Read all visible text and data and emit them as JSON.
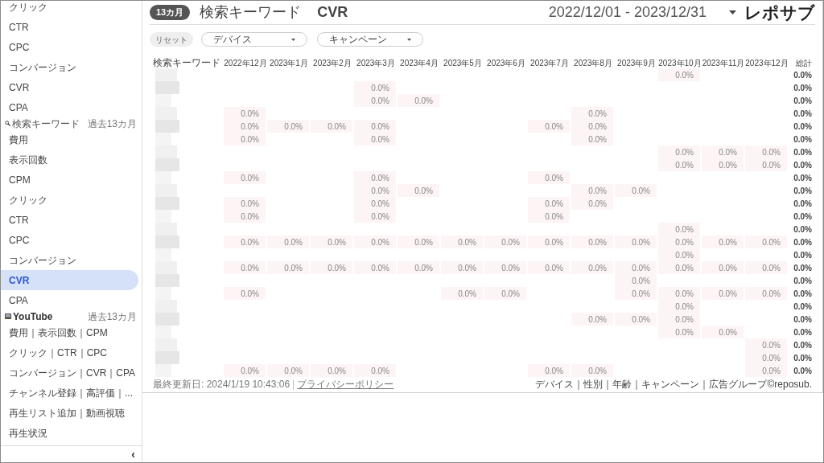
{
  "sidebar": {
    "items": [
      {
        "kind": "item",
        "label": "クリック",
        "selected": false
      },
      {
        "kind": "item",
        "label": "CTR",
        "selected": false
      },
      {
        "kind": "item",
        "label": "CPC",
        "selected": false
      },
      {
        "kind": "item",
        "label": "コンバージョン",
        "selected": false
      },
      {
        "kind": "item",
        "label": "CVR",
        "selected": false
      },
      {
        "kind": "item",
        "label": "CPA",
        "selected": false
      },
      {
        "kind": "header",
        "label": "検索キーワード",
        "period": "過去13カ月"
      },
      {
        "kind": "item",
        "label": "費用",
        "selected": false
      },
      {
        "kind": "item",
        "label": "表示回数",
        "selected": false
      },
      {
        "kind": "item",
        "label": "CPM",
        "selected": false
      },
      {
        "kind": "item",
        "label": "クリック",
        "selected": false
      },
      {
        "kind": "item",
        "label": "CTR",
        "selected": false
      },
      {
        "kind": "item",
        "label": "CPC",
        "selected": false
      },
      {
        "kind": "item",
        "label": "コンバージョン",
        "selected": false
      },
      {
        "kind": "item",
        "label": "CVR",
        "selected": true
      },
      {
        "kind": "item",
        "label": "CPA",
        "selected": false
      },
      {
        "kind": "header",
        "label": "YouTube",
        "period": "過去13カ月"
      },
      {
        "kind": "item",
        "label": "費用｜表示回数｜CPM",
        "selected": false
      },
      {
        "kind": "item",
        "label": "クリック｜CTR｜CPC",
        "selected": false
      },
      {
        "kind": "item",
        "label": "コンバージョン｜CVR｜CPA",
        "selected": false
      },
      {
        "kind": "item",
        "label": "チャンネル登録｜高評価｜...",
        "selected": false
      },
      {
        "kind": "item",
        "label": "再生リスト追加｜動画視聴",
        "selected": false
      },
      {
        "kind": "item",
        "label": "再生状況",
        "selected": false
      }
    ],
    "collapse": "‹"
  },
  "header": {
    "badge": "13カ月",
    "title": "検索キーワード",
    "metric": "CVR",
    "date_range": "2022/12/01 - 2023/12/31",
    "logo": "レポサブ"
  },
  "filters": {
    "reset": "リセット",
    "dropdowns": [
      "デバイス",
      "キャンペーン"
    ]
  },
  "table": {
    "keyword_header": "検索キーワード",
    "total_header": "総計",
    "columns": [
      "2022年12月",
      "2023年1月",
      "2023年2月",
      "2023年3月",
      "2023年4月",
      "2023年5月",
      "2023年6月",
      "2023年7月",
      "2023年8月",
      "2023年9月",
      "2023年10月",
      "2023年11月",
      "2023年12月"
    ],
    "rows": [
      {
        "cells": [
          null,
          null,
          null,
          null,
          null,
          null,
          null,
          null,
          null,
          null,
          "0.0%",
          null,
          null
        ],
        "total": "0.0%"
      },
      {
        "cells": [
          null,
          null,
          null,
          "0.0%",
          null,
          null,
          null,
          null,
          null,
          null,
          null,
          null,
          null
        ],
        "total": "0.0%"
      },
      {
        "cells": [
          null,
          null,
          null,
          "0.0%",
          "0.0%",
          null,
          null,
          null,
          null,
          null,
          null,
          null,
          null
        ],
        "total": "0.0%"
      },
      {
        "cells": [
          "0.0%",
          null,
          null,
          null,
          null,
          null,
          null,
          null,
          "0.0%",
          null,
          null,
          null,
          null
        ],
        "total": "0.0%"
      },
      {
        "cells": [
          "0.0%",
          "0.0%",
          "0.0%",
          "0.0%",
          null,
          null,
          null,
          "0.0%",
          "0.0%",
          null,
          null,
          null,
          null
        ],
        "total": "0.0%"
      },
      {
        "cells": [
          "0.0%",
          null,
          null,
          "0.0%",
          null,
          null,
          null,
          null,
          "0.0%",
          null,
          null,
          null,
          null
        ],
        "total": "0.0%"
      },
      {
        "cells": [
          null,
          null,
          null,
          null,
          null,
          null,
          null,
          null,
          null,
          null,
          "0.0%",
          "0.0%",
          "0.0%"
        ],
        "total": "0.0%"
      },
      {
        "cells": [
          null,
          null,
          null,
          null,
          null,
          null,
          null,
          null,
          null,
          null,
          "0.0%",
          "0.0%",
          "0.0%"
        ],
        "total": "0.0%"
      },
      {
        "cells": [
          "0.0%",
          null,
          null,
          "0.0%",
          null,
          null,
          null,
          "0.0%",
          null,
          null,
          null,
          null,
          null
        ],
        "total": "0.0%"
      },
      {
        "cells": [
          null,
          null,
          null,
          "0.0%",
          "0.0%",
          null,
          null,
          null,
          "0.0%",
          "0.0%",
          null,
          null,
          null
        ],
        "total": "0.0%"
      },
      {
        "cells": [
          "0.0%",
          null,
          null,
          "0.0%",
          null,
          null,
          null,
          "0.0%",
          "0.0%",
          null,
          null,
          null,
          null
        ],
        "total": "0.0%"
      },
      {
        "cells": [
          "0.0%",
          null,
          null,
          "0.0%",
          null,
          null,
          null,
          "0.0%",
          null,
          null,
          null,
          null,
          null
        ],
        "total": "0.0%"
      },
      {
        "cells": [
          null,
          null,
          null,
          null,
          null,
          null,
          null,
          null,
          null,
          null,
          "0.0%",
          null,
          null
        ],
        "total": "0.0%"
      },
      {
        "cells": [
          "0.0%",
          "0.0%",
          "0.0%",
          "0.0%",
          "0.0%",
          "0.0%",
          "0.0%",
          "0.0%",
          "0.0%",
          "0.0%",
          "0.0%",
          "0.0%",
          "0.0%"
        ],
        "total": "0.0%"
      },
      {
        "cells": [
          null,
          null,
          null,
          null,
          null,
          null,
          null,
          null,
          null,
          null,
          "0.0%",
          null,
          null
        ],
        "total": "0.0%"
      },
      {
        "cells": [
          "0.0%",
          "0.0%",
          "0.0%",
          "0.0%",
          "0.0%",
          "0.0%",
          "0.0%",
          "0.0%",
          "0.0%",
          "0.0%",
          "0.0%",
          "0.0%",
          "0.0%"
        ],
        "total": "0.0%"
      },
      {
        "cells": [
          null,
          null,
          null,
          null,
          null,
          null,
          null,
          null,
          null,
          "0.0%",
          null,
          null,
          null
        ],
        "total": "0.0%"
      },
      {
        "cells": [
          "0.0%",
          null,
          null,
          null,
          null,
          "0.0%",
          "0.0%",
          null,
          null,
          "0.0%",
          "0.0%",
          "0.0%",
          "0.0%"
        ],
        "total": "0.0%"
      },
      {
        "cells": [
          null,
          null,
          null,
          null,
          null,
          null,
          null,
          null,
          null,
          null,
          "0.0%",
          null,
          null
        ],
        "total": "0.0%"
      },
      {
        "cells": [
          null,
          null,
          null,
          null,
          null,
          null,
          null,
          null,
          "0.0%",
          "0.0%",
          "0.0%",
          null,
          null
        ],
        "total": "0.0%"
      },
      {
        "cells": [
          null,
          null,
          null,
          null,
          null,
          null,
          null,
          null,
          null,
          null,
          "0.0%",
          "0.0%",
          null
        ],
        "total": "0.0%"
      },
      {
        "cells": [
          null,
          null,
          null,
          null,
          null,
          null,
          null,
          null,
          null,
          null,
          null,
          null,
          "0.0%"
        ],
        "total": "0.0%"
      },
      {
        "cells": [
          null,
          null,
          null,
          null,
          null,
          null,
          null,
          null,
          null,
          null,
          null,
          null,
          "0.0%"
        ],
        "total": "0.0%"
      },
      {
        "cells": [
          "0.0%",
          "0.0%",
          "0.0%",
          "0.0%",
          null,
          null,
          null,
          "0.0%",
          "0.0%",
          null,
          null,
          null,
          "0.0%"
        ],
        "total": "0.0%"
      }
    ]
  },
  "footer": {
    "updated": "最終更新日: 2024/1/19 10:43:06",
    "separator": "|",
    "privacy_link": "プライバシーポリシー",
    "notes": "デバイス｜性別｜年齢｜キャンペーン｜広告グループ©reposub."
  }
}
